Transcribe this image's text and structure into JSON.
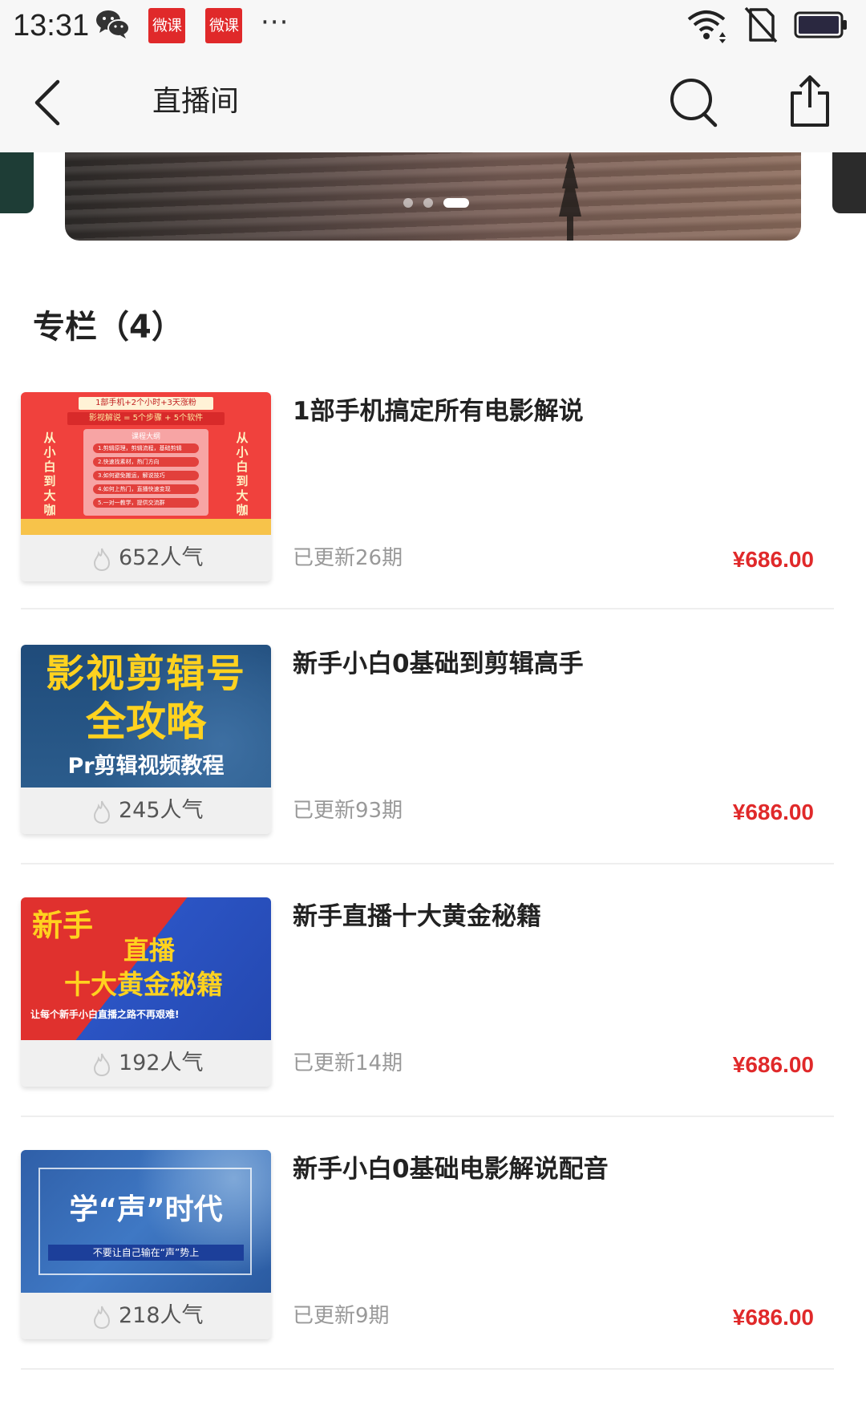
{
  "status_bar": {
    "time": "13:31",
    "badges": [
      "微课",
      "微课"
    ],
    "more": "···",
    "icons": [
      "wechat-icon",
      "wifi-icon",
      "sim-icon",
      "battery-icon"
    ]
  },
  "nav": {
    "title": "直播间",
    "icons": [
      "back-icon",
      "search-icon",
      "share-icon"
    ]
  },
  "banner": {
    "slide_count": 3,
    "active_slide": 3
  },
  "section": {
    "title": "专栏（4）"
  },
  "columns": [
    {
      "title": "1部手机搞定所有电影解说",
      "popularity": "652人气",
      "updates": "已更新26期",
      "price": "¥686.00",
      "thumb": {
        "header1": "1部手机+2个小时+3天涨粉",
        "header2": "影视解说 = 5个步骤 + 5个软件",
        "box_title": "课程大纲",
        "pills": [
          "1.剪辑原理，剪辑流程，基础剪辑",
          "2.快速找素材，热门方向",
          "3.如何避免搬运，解说技巧",
          "4.如何上热门，直播快速变现",
          "5.一对一教学，提供交流群"
        ],
        "side_text": "从小白到大咖"
      }
    },
    {
      "title": "新手小白0基础到剪辑高手",
      "popularity": "245人气",
      "updates": "已更新93期",
      "price": "¥686.00",
      "thumb": {
        "line1": "影视剪辑号",
        "line2": "全攻略",
        "line3": "Pr剪辑视频教程"
      }
    },
    {
      "title": "新手直播十大黄金秘籍",
      "popularity": "192人气",
      "updates": "已更新14期",
      "price": "¥686.00",
      "thumb": {
        "line1": "新手",
        "line2": "直播",
        "line3": "十大黄金秘籍",
        "line4": "让每个新手小白直播之路不再艰难!"
      }
    },
    {
      "title": "新手小白0基础电影解说配音",
      "popularity": "218人气",
      "updates": "已更新9期",
      "price": "¥686.00",
      "thumb": {
        "line1": "学“声”时代",
        "line2": "不要让自己输在“声”势上"
      }
    }
  ],
  "colors": {
    "price": "#e0292a",
    "badge": "#e0292a",
    "bar_bg": "#f7f7f7"
  }
}
